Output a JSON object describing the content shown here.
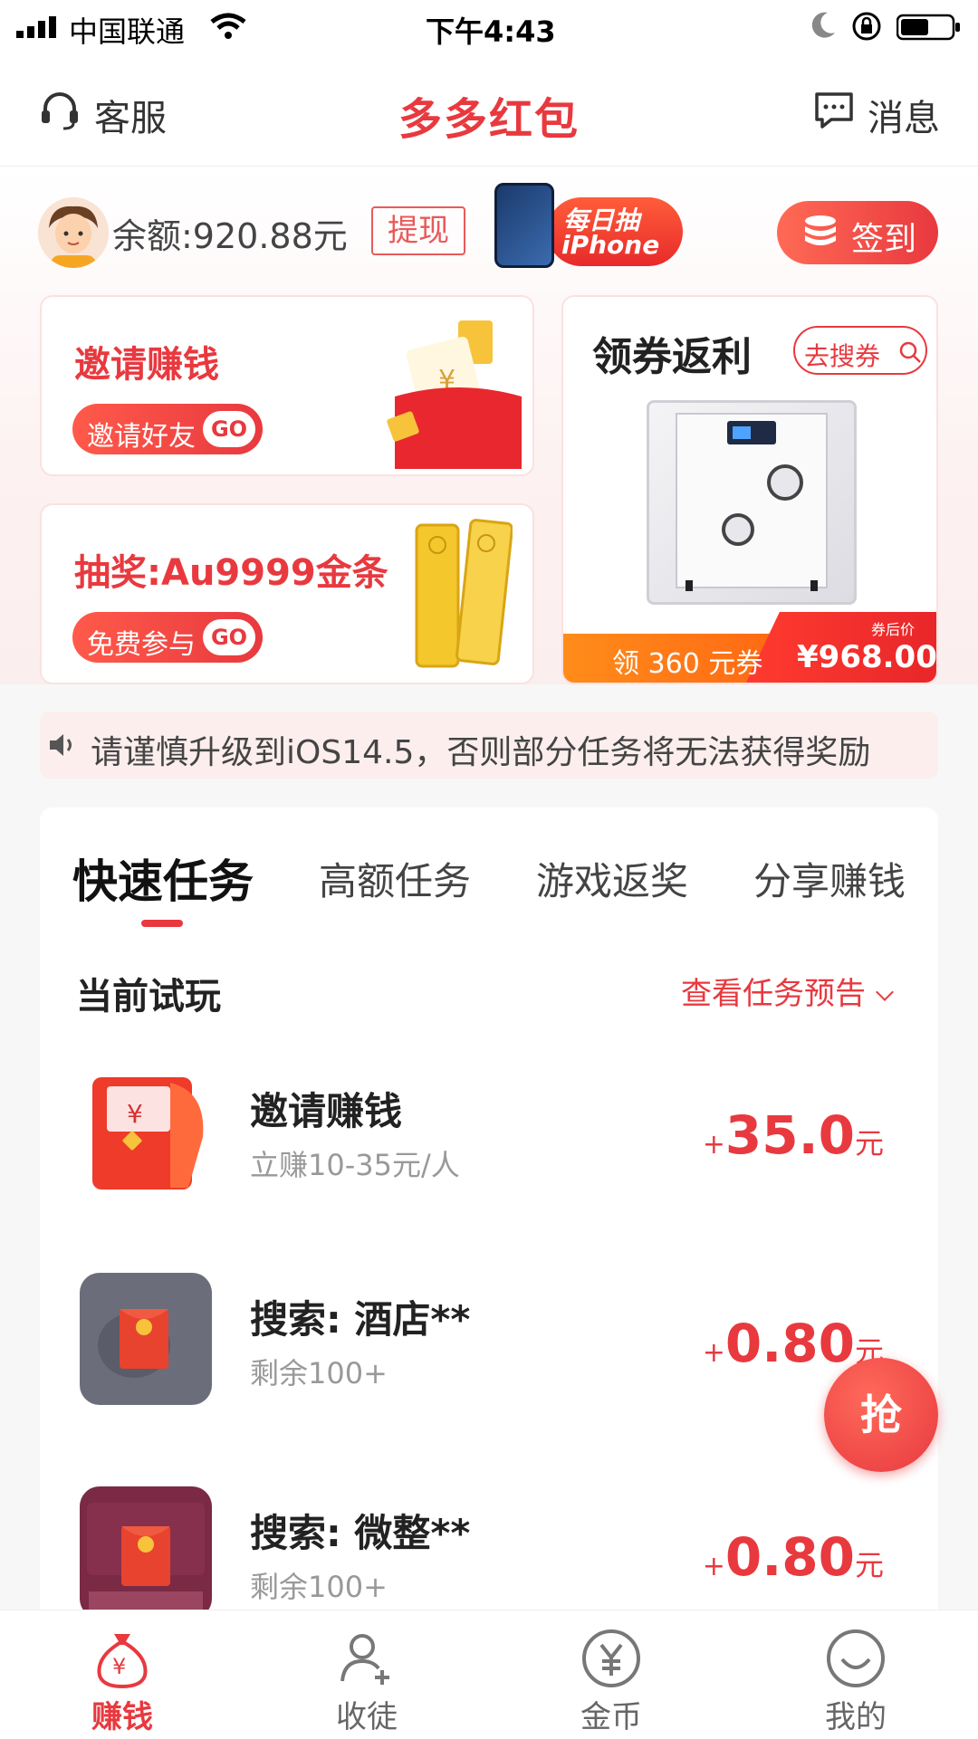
{
  "status_bar": {
    "carrier": "中国联通",
    "time": "下午4:43"
  },
  "header": {
    "customer_service": "客服",
    "title": "多多红包",
    "messages": "消息"
  },
  "account": {
    "balance": "余额:920.88元",
    "withdraw": "提现",
    "banner_line1": "每日抽",
    "banner_line2": "iPhone",
    "signin": "签到"
  },
  "cards": {
    "invite": {
      "title": "邀请赚钱",
      "button": "邀请好友",
      "go": "GO"
    },
    "lottery": {
      "title": "抽奖:Au9999金条",
      "button": "免费参与",
      "go": "GO"
    },
    "coupon": {
      "title": "领券返利",
      "search": "去搜券",
      "coupon_amount": "领 360 元券",
      "after_label": "券后价",
      "price": "¥968.00"
    }
  },
  "notice": "请谨慎升级到iOS14.5，否则部分任务将无法获得奖励",
  "tabs": [
    "快速任务",
    "高额任务",
    "游戏返奖",
    "分享赚钱"
  ],
  "section": {
    "title": "当前试玩",
    "preview": "查看任务预告"
  },
  "tasks": [
    {
      "name": "邀请赚钱",
      "sub": "立赚10-35元/人",
      "plus": "+",
      "amount": "35.0",
      "unit": "元"
    },
    {
      "name": "搜索: 酒店**",
      "sub": "剩余100+",
      "plus": "+",
      "amount": "0.80",
      "unit": "元"
    },
    {
      "name": "搜索: 微整**",
      "sub": "剩余100+",
      "plus": "+",
      "amount": "0.80",
      "unit": "元"
    }
  ],
  "grab": "抢",
  "bottom_nav": [
    {
      "label": "赚钱",
      "icon": "money-bag-icon",
      "active": true
    },
    {
      "label": "收徒",
      "icon": "add-user-icon",
      "active": false
    },
    {
      "label": "金币",
      "icon": "yen-coin-icon",
      "active": false
    },
    {
      "label": "我的",
      "icon": "smile-icon",
      "active": false
    }
  ],
  "colors": {
    "accent": "#e8393f",
    "orange": "#ff8c1a"
  }
}
